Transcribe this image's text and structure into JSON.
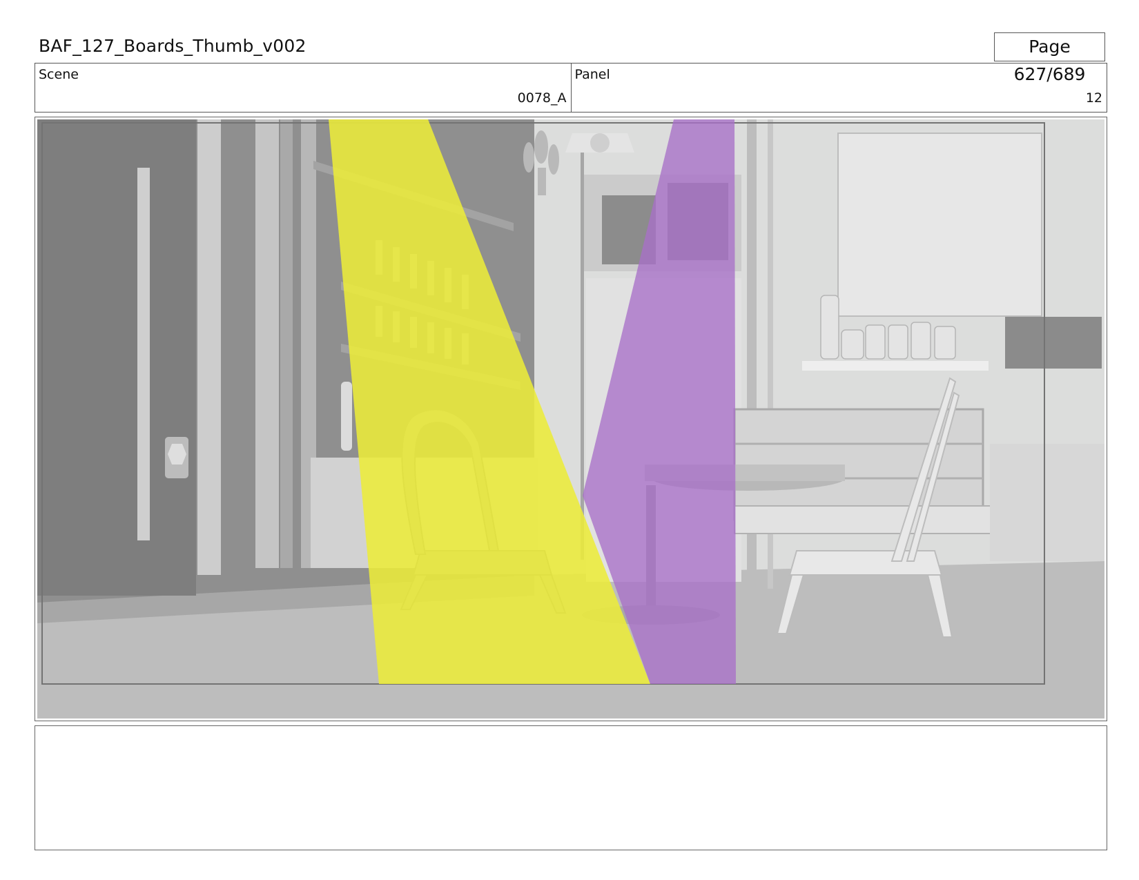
{
  "document": {
    "title": "BAF_127_Boards_Thumb_v002",
    "page_label": "Page 627/689"
  },
  "info": {
    "scene_label": "Scene",
    "scene_value": "0078_A",
    "panel_label": "Panel",
    "panel_value": "12"
  },
  "panel_image": {
    "content": "grey-shaded 3D cafe interior with chairs, round table, shelves and display case",
    "overlays": [
      {
        "name": "yellow-light-beam",
        "color": "#ecec3a"
      },
      {
        "name": "purple-light-beam",
        "color": "#a86fc8"
      }
    ]
  },
  "notes": {
    "text": ""
  }
}
